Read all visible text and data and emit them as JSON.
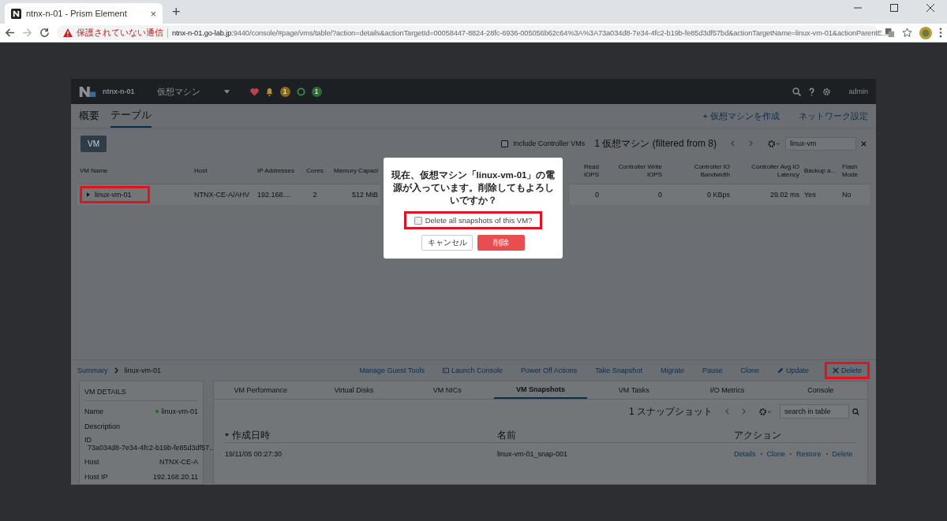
{
  "browser": {
    "tab_title": "ntnx-n-01 - Prism Element",
    "tab_close": "×",
    "new_tab": "+",
    "security_warning": "保護されていない通信",
    "url_host": "ntnx-n-01.go-lab.jp",
    "url_rest": ":9440/console/#page/vms/table/?action=details&actionTargetId=00058447-8824-28fc-6936-005056b62c64%3A%3A73a034d8-7e34-4fc2-b19b-fe85d3df57bd&actionTargetName=linux-vm-01&actionParentE..."
  },
  "app": {
    "cluster": "ntnx-n-01",
    "section_menu": "仮想マシン",
    "alert_count": "1",
    "task_count": "1",
    "user": "admin"
  },
  "subnav": {
    "tabs": [
      {
        "label": "概要",
        "selected": false
      },
      {
        "label": "テーブル",
        "selected": true
      }
    ],
    "actions": [
      "+ 仮想マシンを作成",
      "ネットワーク設定"
    ]
  },
  "toolbar": {
    "vm_button": "VM",
    "include_controller": {
      "label": "Include Controller VMs",
      "checked": false
    },
    "count": "1 仮想マシン (filtered from 8)",
    "search": "linux-vm"
  },
  "table": {
    "columns": [
      "VM Name",
      "Host",
      "IP Addresses",
      "Cores",
      "Memory Capaci",
      "Read IOPS",
      "Controller Write IOPS",
      "Controller IO Bandwidth",
      "Controller Avg IO Latency",
      "Backup a...",
      "Flash Mode"
    ],
    "rows": [
      {
        "cells": [
          "linux-vm-01",
          "NTNX-CE-A/AHV",
          "192.168....",
          "2",
          "512 MiB",
          "0",
          "0",
          "0 KBps",
          "29.02 ms",
          "Yes",
          "No"
        ],
        "highlighted": true
      }
    ]
  },
  "details": {
    "breadcrumb": [
      "Summary",
      "linux-vm-01"
    ],
    "actions": [
      {
        "label": "Manage Guest Tools",
        "kind": "plain",
        "highlighted": false
      },
      {
        "label": "Launch Console",
        "kind": "console",
        "highlighted": false
      },
      {
        "label": "Power Off Actions",
        "kind": "plain",
        "highlighted": false
      },
      {
        "label": "Take Snapshot",
        "kind": "plain",
        "highlighted": false
      },
      {
        "label": "Migrate",
        "kind": "plain",
        "highlighted": false
      },
      {
        "label": "Pause",
        "kind": "plain",
        "highlighted": false
      },
      {
        "label": "Clone",
        "kind": "plain",
        "highlighted": false
      },
      {
        "label": "Update",
        "kind": "pencil",
        "highlighted": false
      },
      {
        "label": "Delete",
        "kind": "cross",
        "highlighted": true
      }
    ],
    "vm_details_title": "VM DETAILS",
    "fields": [
      {
        "label": "Name",
        "value": "linux-vm-01",
        "kind": "status"
      },
      {
        "label": "Description",
        "kind": "empty"
      },
      {
        "label": "ID",
        "value": "73a034d8-7e34-4fc2-b19b-fe85d3df57...",
        "kind": "block"
      },
      {
        "label": "Host",
        "value": "NTNX-CE-A",
        "kind": "inline"
      },
      {
        "label": "Host IP",
        "value": "192.168.20.11",
        "kind": "inline"
      }
    ],
    "tabs": [
      {
        "label": "VM Performance",
        "selected": false
      },
      {
        "label": "Virtual Disks",
        "selected": false
      },
      {
        "label": "VM NICs",
        "selected": false
      },
      {
        "label": "VM Snapshots",
        "selected": true
      },
      {
        "label": "VM Tasks",
        "selected": false
      },
      {
        "label": "I/O Metrics",
        "selected": false
      },
      {
        "label": "Console",
        "selected": false
      }
    ],
    "snapshot_count": "1 スナップショット",
    "search_placeholder": "search in table",
    "snapshot_columns": [
      "作成日時",
      "名前",
      "アクション"
    ],
    "snapshots": [
      {
        "created": "19/11/05 00:27:30",
        "name": "linux-vm-01_snap-001",
        "actions": [
          "Details",
          "Clone",
          "Restore",
          "Delete"
        ]
      }
    ]
  },
  "dialog": {
    "message": "現在、仮想マシン「linux-vm-01」の電源が入っています。削除してもよろしいですか？",
    "checkbox": {
      "label": "Delete all snapshots of this VM?",
      "checked": false,
      "highlighted": true
    },
    "cancel": "キャンセル",
    "confirm": "削除"
  }
}
